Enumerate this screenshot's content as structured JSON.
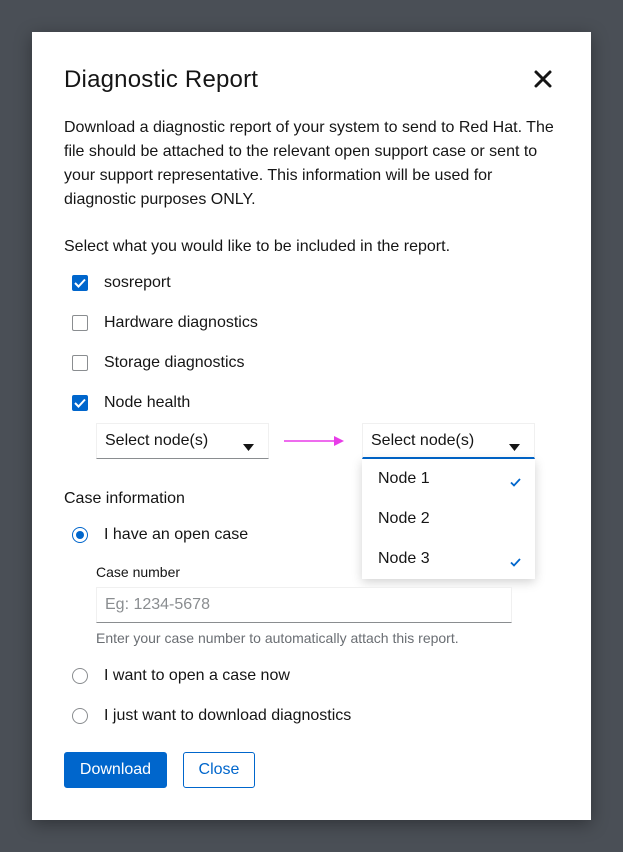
{
  "modal": {
    "title": "Diagnostic Report",
    "description": "Download a diagnostic report of your system to send to Red Hat. The file should be attached to the relevant open support case or sent to your support representative. This information will be used for diagnostic purposes ONLY.",
    "prompt": "Select what you would like to be included in the report."
  },
  "options": [
    {
      "label": "sosreport",
      "checked": true
    },
    {
      "label": "Hardware diagnostics",
      "checked": false
    },
    {
      "label": "Storage diagnostics",
      "checked": false
    },
    {
      "label": "Node health",
      "checked": true
    }
  ],
  "node_select": {
    "closed_label": "Select node(s)",
    "open_label": "Select node(s)",
    "items": [
      {
        "label": "Node 1",
        "selected": true
      },
      {
        "label": "Node 2",
        "selected": false
      },
      {
        "label": "Node 3",
        "selected": true
      }
    ]
  },
  "case": {
    "section_title": "Case information",
    "radios": [
      {
        "label": "I have an open case",
        "selected": true
      },
      {
        "label": "I want to open a case now",
        "selected": false
      },
      {
        "label": "I just want to download diagnostics",
        "selected": false
      }
    ],
    "field_label": "Case number",
    "placeholder": "Eg: 1234-5678",
    "value": "",
    "helper": "Enter your case number to automatically attach this report."
  },
  "buttons": {
    "download": "Download",
    "close": "Close"
  },
  "colors": {
    "accent": "#0066cc",
    "overlay": "#4a4f56",
    "annotation_arrow": "#e83ce8"
  },
  "icons": {
    "close": "close-icon",
    "caret": "caret-down-icon",
    "check": "check-icon"
  }
}
